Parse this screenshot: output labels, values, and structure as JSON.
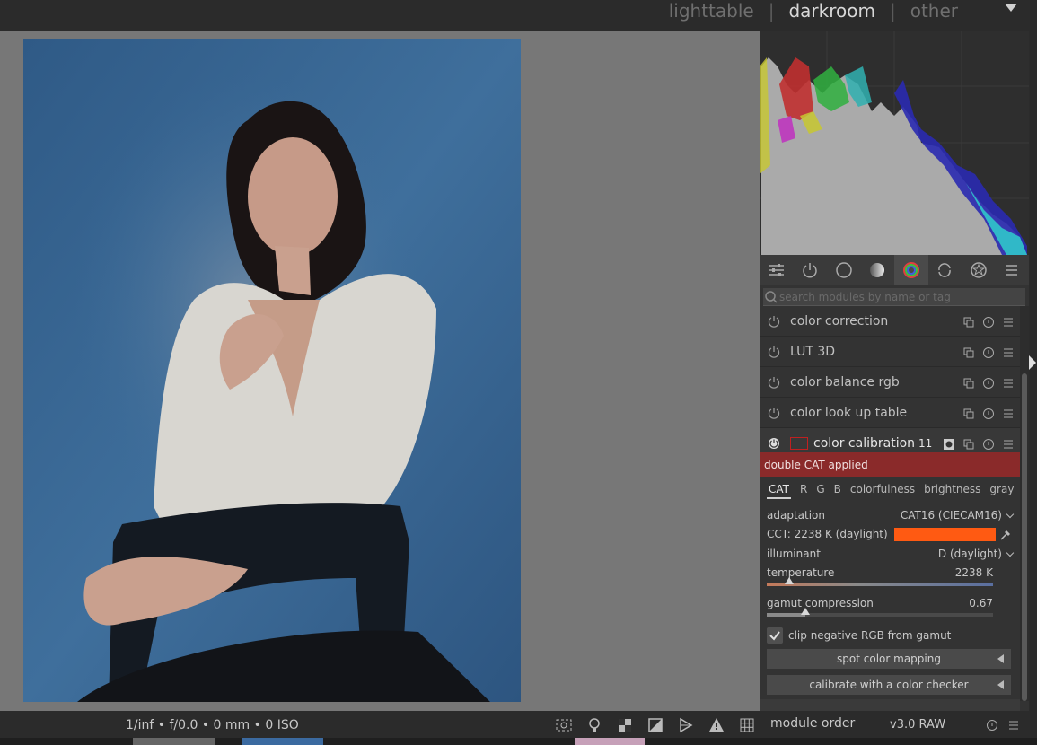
{
  "views": {
    "lighttable": "lighttable",
    "darkroom": "darkroom",
    "other": "other",
    "sep1": "|",
    "sep2": "|"
  },
  "search": {
    "placeholder": "search modules by name or tag"
  },
  "modules": [
    {
      "label": "color correction"
    },
    {
      "label": "LUT 3D"
    },
    {
      "label": "color balance rgb"
    },
    {
      "label": "color look up table"
    }
  ],
  "expanded_module": {
    "label": "color calibration",
    "instance": "11"
  },
  "warning": "double CAT applied",
  "calibration_tabs": [
    "CAT",
    "R",
    "G",
    "B",
    "colorfulness",
    "brightness",
    "gray"
  ],
  "adaptation": {
    "label": "adaptation",
    "value": "CAT16 (CIECAM16)"
  },
  "cct": {
    "label": "CCT: 2238 K (daylight)",
    "swatch_color": "#ff5a12"
  },
  "illuminant": {
    "label": "illuminant",
    "value": "D (daylight)"
  },
  "temperature": {
    "label": "temperature",
    "value": "2238 K",
    "position_fraction": 0.1
  },
  "gamut": {
    "label": "gamut compression",
    "value": "0.67",
    "position_fraction": 0.17
  },
  "clip_checkbox": {
    "label": "clip negative RGB from gamut",
    "checked": true
  },
  "spot_button": "spot color mapping",
  "checker_button": "calibrate with a color checker",
  "status": {
    "exif": "1/inf • f/0.0 • 0 mm • 0 ISO",
    "module_order_label": "module order",
    "module_order_value": "v3.0 RAW"
  }
}
